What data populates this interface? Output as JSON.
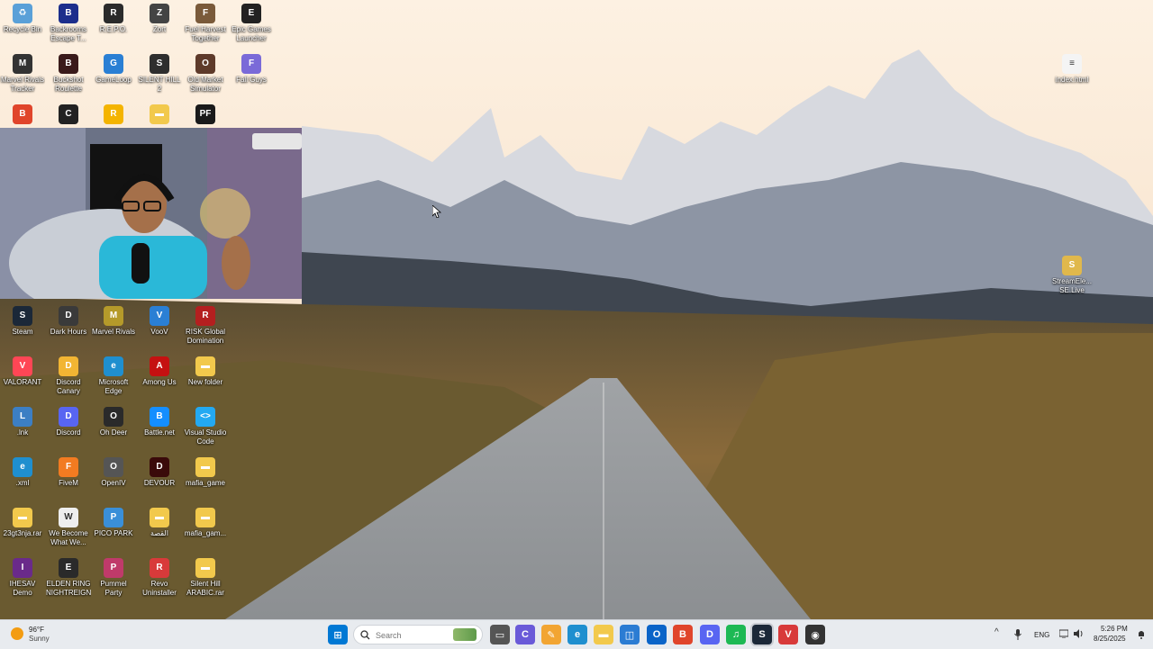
{
  "desktop_icons": [
    {
      "id": "recycle-bin",
      "label": "Recycle Bin",
      "glyph": "♻",
      "color": "#5aa0d8"
    },
    {
      "id": "backrooms",
      "label": "Backrooms Escape T...",
      "glyph": "B",
      "color": "#1c2e8c"
    },
    {
      "id": "repo",
      "label": "R.E.P.O.",
      "glyph": "R",
      "color": "#2b2b2b"
    },
    {
      "id": "zort",
      "label": "Zort",
      "glyph": "Z",
      "color": "#444"
    },
    {
      "id": "fuel-harvest",
      "label": "Fuel Harvest Together",
      "glyph": "F",
      "color": "#7a5a3a"
    },
    {
      "id": "epic-games",
      "label": "Epic Games Launcher",
      "glyph": "E",
      "color": "#222"
    },
    {
      "id": "marvel-rivals-tracker",
      "label": "Marvel Rivals Tracker",
      "glyph": "M",
      "color": "#333"
    },
    {
      "id": "buckshot",
      "label": "Buckshot Roulette",
      "glyph": "B",
      "color": "#3a1a1a"
    },
    {
      "id": "gameloop",
      "label": "GameLoop",
      "glyph": "G",
      "color": "#2a7fd4"
    },
    {
      "id": "silent-hill-2",
      "label": "SILENT HILL 2",
      "glyph": "S",
      "color": "#2e2e2e"
    },
    {
      "id": "old-market",
      "label": "Old Market Simulator",
      "glyph": "O",
      "color": "#5e3a2a"
    },
    {
      "id": "fall-guys",
      "label": "Fall Guys",
      "glyph": "F",
      "color": "#7a6ad8"
    },
    {
      "id": "brave",
      "label": "",
      "glyph": "B",
      "color": "#e0452b"
    },
    {
      "id": "capcut",
      "label": "",
      "glyph": "C",
      "color": "#222"
    },
    {
      "id": "rockstar",
      "label": "",
      "glyph": "R",
      "color": "#f4b400"
    },
    {
      "id": "folder-top",
      "label": "",
      "glyph": "▬",
      "color": "#f2c94c"
    },
    {
      "id": "pf",
      "label": "",
      "glyph": "PF",
      "color": "#1a1a1a"
    },
    {
      "id": "index-html",
      "label": "index.html",
      "glyph": "≡",
      "color": "#f4f4f4"
    },
    {
      "id": "streamelements",
      "label": "StreamEle... SE.Live",
      "glyph": "S",
      "color": "#e0b84c"
    },
    {
      "id": "steam",
      "label": "Steam",
      "glyph": "S",
      "color": "#1b2838"
    },
    {
      "id": "dark-hours",
      "label": "Dark Hours",
      "glyph": "D",
      "color": "#3a3a3a"
    },
    {
      "id": "marvel-rivals",
      "label": "Marvel Rivals",
      "glyph": "M",
      "color": "#b59a2a"
    },
    {
      "id": "voov",
      "label": "VooV",
      "glyph": "V",
      "color": "#2a7fd4"
    },
    {
      "id": "risk",
      "label": "RISK Global Domination",
      "glyph": "R",
      "color": "#b41f1f"
    },
    {
      "id": "valorant",
      "label": "VALORANT",
      "glyph": "V",
      "color": "#ff4655"
    },
    {
      "id": "discord-canary",
      "label": "Discord Canary",
      "glyph": "D",
      "color": "#f2b533"
    },
    {
      "id": "edge",
      "label": "Microsoft Edge",
      "glyph": "e",
      "color": "#1f8fcf"
    },
    {
      "id": "among-us",
      "label": "Among Us",
      "glyph": "A",
      "color": "#c51111"
    },
    {
      "id": "new-folder",
      "label": "New folder",
      "glyph": "▬",
      "color": "#f2c94c"
    },
    {
      "id": "lnk",
      "label": ".lnk",
      "glyph": "L",
      "color": "#3c7fc4"
    },
    {
      "id": "discord",
      "label": "Discord",
      "glyph": "D",
      "color": "#5865f2"
    },
    {
      "id": "oh-deer",
      "label": "Oh Deer",
      "glyph": "O",
      "color": "#2a2a2a"
    },
    {
      "id": "battle-net",
      "label": "Battle.net",
      "glyph": "B",
      "color": "#148eff"
    },
    {
      "id": "vscode",
      "label": "Visual Studio Code",
      "glyph": "<>",
      "color": "#23a9f2"
    },
    {
      "id": "xml",
      "label": ".xml",
      "glyph": "e",
      "color": "#1f8fcf"
    },
    {
      "id": "fivem",
      "label": "FiveM",
      "glyph": "F",
      "color": "#f27b21"
    },
    {
      "id": "openiv",
      "label": "OpenIV",
      "glyph": "O",
      "color": "#555"
    },
    {
      "id": "devour",
      "label": "DEVOUR",
      "glyph": "D",
      "color": "#3a0a0a"
    },
    {
      "id": "mafia-game",
      "label": "mafia_game",
      "glyph": "▬",
      "color": "#f2c94c"
    },
    {
      "id": "rar-23gt",
      "label": "23gt3nja.rar",
      "glyph": "▬",
      "color": "#f2c94c"
    },
    {
      "id": "we-become",
      "label": "We Become What We...",
      "glyph": "W",
      "color": "#eee"
    },
    {
      "id": "pico-park",
      "label": "PICO PARK",
      "glyph": "P",
      "color": "#3a8fd8"
    },
    {
      "id": "arabic-folder",
      "label": "القصة",
      "glyph": "▬",
      "color": "#f2c94c"
    },
    {
      "id": "mafia-game-2",
      "label": "mafia_gam...",
      "glyph": "▬",
      "color": "#f2c94c"
    },
    {
      "id": "ihesav",
      "label": "IHESAV Demo",
      "glyph": "I",
      "color": "#6a2a8a"
    },
    {
      "id": "elden-ring",
      "label": "ELDEN RING NIGHTREIGN",
      "glyph": "E",
      "color": "#2a2a2a"
    },
    {
      "id": "pummel-party",
      "label": "Pummel Party",
      "glyph": "P",
      "color": "#c03a6a"
    },
    {
      "id": "revo",
      "label": "Revo Uninstaller",
      "glyph": "R",
      "color": "#d83a3a"
    },
    {
      "id": "silent-hill-arabic",
      "label": "Silent Hill ARABIC.rar",
      "glyph": "▬",
      "color": "#f2c94c"
    }
  ],
  "taskbar": {
    "weather_temp": "96°F",
    "weather_desc": "Sunny",
    "search_placeholder": "Search",
    "language": "ENG",
    "time": "5:26 PM",
    "date": "8/25/2025",
    "pinned": [
      {
        "id": "start",
        "glyph": "⊞",
        "color": "#0078d4"
      },
      {
        "id": "task-view",
        "glyph": "▭",
        "color": "#555"
      },
      {
        "id": "copilot",
        "glyph": "C",
        "color": "#6a5ad8"
      },
      {
        "id": "paint",
        "glyph": "✎",
        "color": "#f2a533"
      },
      {
        "id": "edge",
        "glyph": "e",
        "color": "#1f8fcf"
      },
      {
        "id": "file-explorer",
        "glyph": "▬",
        "color": "#f2c94c"
      },
      {
        "id": "store",
        "glyph": "◫",
        "color": "#2b7cd3"
      },
      {
        "id": "outlook",
        "glyph": "O",
        "color": "#0a64c8"
      },
      {
        "id": "brave",
        "glyph": "B",
        "color": "#e0452b"
      },
      {
        "id": "discord",
        "glyph": "D",
        "color": "#5865f2"
      },
      {
        "id": "spotify",
        "glyph": "♫",
        "color": "#1db954"
      },
      {
        "id": "steam",
        "glyph": "S",
        "color": "#1b2838"
      },
      {
        "id": "voicemod",
        "glyph": "V",
        "color": "#d83a3a"
      },
      {
        "id": "obs",
        "glyph": "◉",
        "color": "#333"
      }
    ]
  }
}
